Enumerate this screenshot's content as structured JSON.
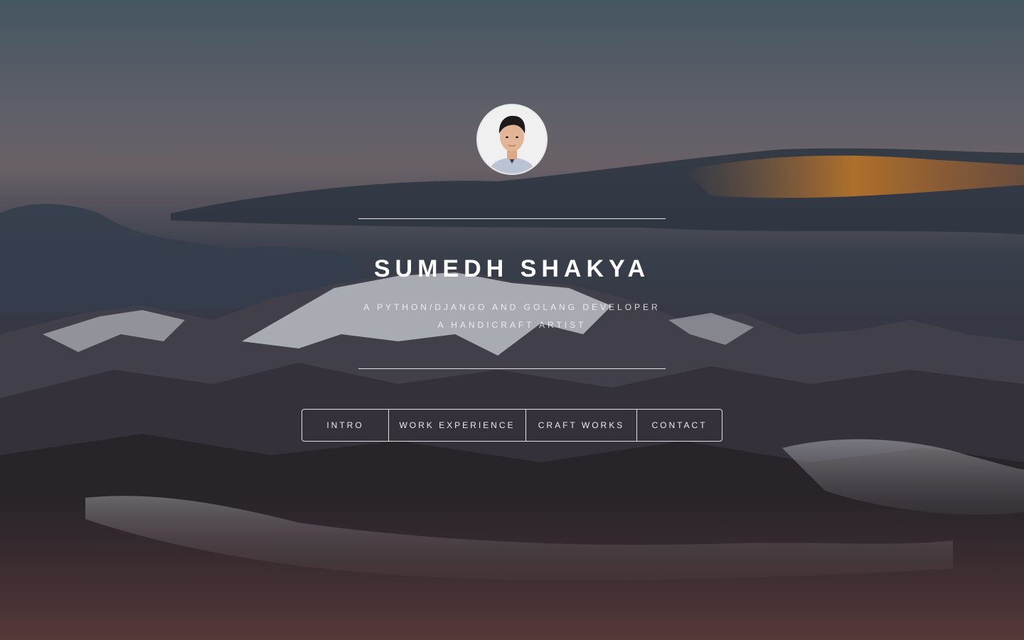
{
  "profile": {
    "name": "SUMEDH SHAKYA",
    "tagline_line1": "A PYTHON/DJANGO AND GOLANG DEVELOPER",
    "tagline_line2": "A HANDICRAFT ARTIST"
  },
  "nav": {
    "items": [
      {
        "label": "INTRO"
      },
      {
        "label": "WORK EXPERIENCE"
      },
      {
        "label": "CRAFT WORKS"
      },
      {
        "label": "CONTACT"
      }
    ]
  },
  "colors": {
    "text": "#ffffff",
    "sky_top": "#4f6470",
    "sunset_glow": "#e08a2a",
    "mountain_dark": "#2c2226"
  }
}
